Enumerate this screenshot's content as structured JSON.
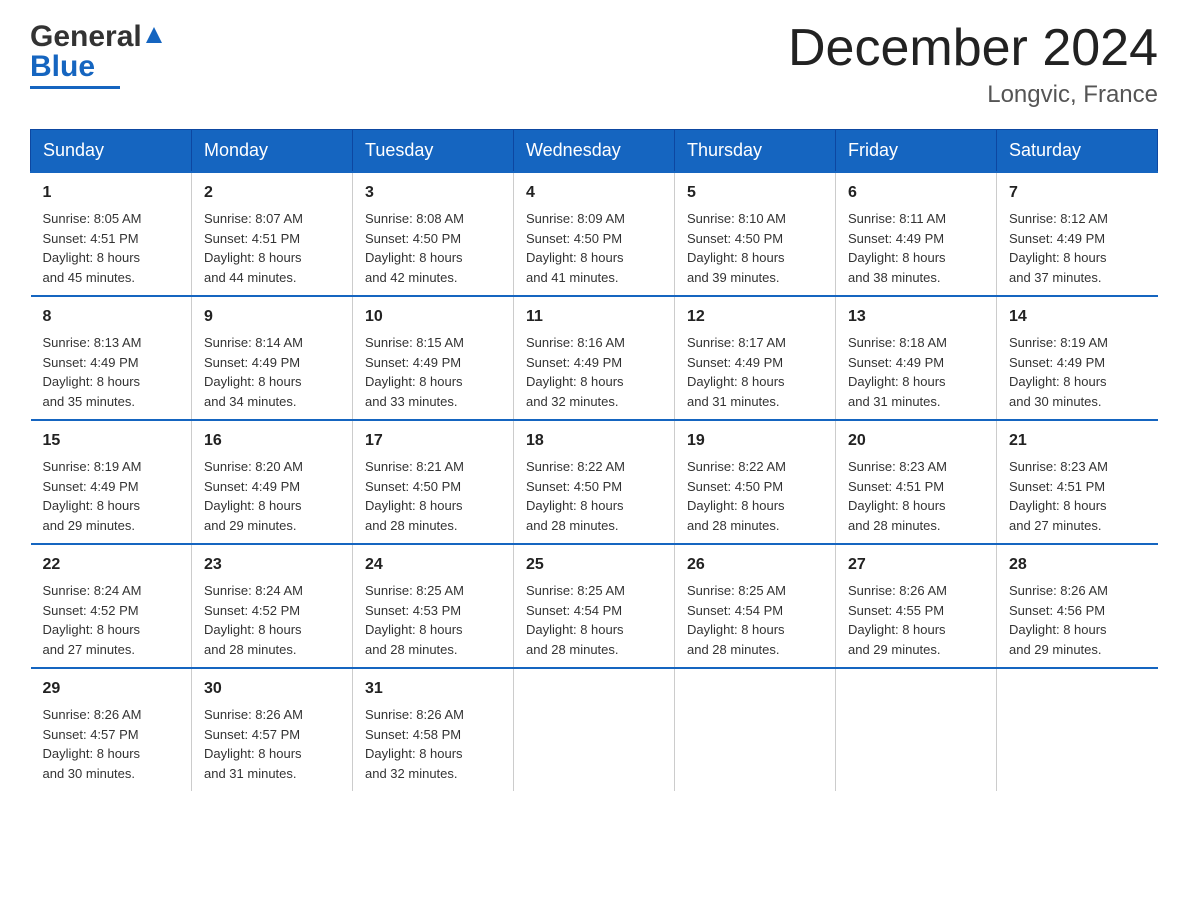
{
  "header": {
    "logo": {
      "line1": "General",
      "line2": "Blue"
    },
    "title": "December 2024",
    "subtitle": "Longvic, France"
  },
  "weekdays": [
    "Sunday",
    "Monday",
    "Tuesday",
    "Wednesday",
    "Thursday",
    "Friday",
    "Saturday"
  ],
  "weeks": [
    [
      {
        "day": "1",
        "sunrise": "8:05 AM",
        "sunset": "4:51 PM",
        "daylight": "8 hours and 45 minutes."
      },
      {
        "day": "2",
        "sunrise": "8:07 AM",
        "sunset": "4:51 PM",
        "daylight": "8 hours and 44 minutes."
      },
      {
        "day": "3",
        "sunrise": "8:08 AM",
        "sunset": "4:50 PM",
        "daylight": "8 hours and 42 minutes."
      },
      {
        "day": "4",
        "sunrise": "8:09 AM",
        "sunset": "4:50 PM",
        "daylight": "8 hours and 41 minutes."
      },
      {
        "day": "5",
        "sunrise": "8:10 AM",
        "sunset": "4:50 PM",
        "daylight": "8 hours and 39 minutes."
      },
      {
        "day": "6",
        "sunrise": "8:11 AM",
        "sunset": "4:49 PM",
        "daylight": "8 hours and 38 minutes."
      },
      {
        "day": "7",
        "sunrise": "8:12 AM",
        "sunset": "4:49 PM",
        "daylight": "8 hours and 37 minutes."
      }
    ],
    [
      {
        "day": "8",
        "sunrise": "8:13 AM",
        "sunset": "4:49 PM",
        "daylight": "8 hours and 35 minutes."
      },
      {
        "day": "9",
        "sunrise": "8:14 AM",
        "sunset": "4:49 PM",
        "daylight": "8 hours and 34 minutes."
      },
      {
        "day": "10",
        "sunrise": "8:15 AM",
        "sunset": "4:49 PM",
        "daylight": "8 hours and 33 minutes."
      },
      {
        "day": "11",
        "sunrise": "8:16 AM",
        "sunset": "4:49 PM",
        "daylight": "8 hours and 32 minutes."
      },
      {
        "day": "12",
        "sunrise": "8:17 AM",
        "sunset": "4:49 PM",
        "daylight": "8 hours and 31 minutes."
      },
      {
        "day": "13",
        "sunrise": "8:18 AM",
        "sunset": "4:49 PM",
        "daylight": "8 hours and 31 minutes."
      },
      {
        "day": "14",
        "sunrise": "8:19 AM",
        "sunset": "4:49 PM",
        "daylight": "8 hours and 30 minutes."
      }
    ],
    [
      {
        "day": "15",
        "sunrise": "8:19 AM",
        "sunset": "4:49 PM",
        "daylight": "8 hours and 29 minutes."
      },
      {
        "day": "16",
        "sunrise": "8:20 AM",
        "sunset": "4:49 PM",
        "daylight": "8 hours and 29 minutes."
      },
      {
        "day": "17",
        "sunrise": "8:21 AM",
        "sunset": "4:50 PM",
        "daylight": "8 hours and 28 minutes."
      },
      {
        "day": "18",
        "sunrise": "8:22 AM",
        "sunset": "4:50 PM",
        "daylight": "8 hours and 28 minutes."
      },
      {
        "day": "19",
        "sunrise": "8:22 AM",
        "sunset": "4:50 PM",
        "daylight": "8 hours and 28 minutes."
      },
      {
        "day": "20",
        "sunrise": "8:23 AM",
        "sunset": "4:51 PM",
        "daylight": "8 hours and 28 minutes."
      },
      {
        "day": "21",
        "sunrise": "8:23 AM",
        "sunset": "4:51 PM",
        "daylight": "8 hours and 27 minutes."
      }
    ],
    [
      {
        "day": "22",
        "sunrise": "8:24 AM",
        "sunset": "4:52 PM",
        "daylight": "8 hours and 27 minutes."
      },
      {
        "day": "23",
        "sunrise": "8:24 AM",
        "sunset": "4:52 PM",
        "daylight": "8 hours and 28 minutes."
      },
      {
        "day": "24",
        "sunrise": "8:25 AM",
        "sunset": "4:53 PM",
        "daylight": "8 hours and 28 minutes."
      },
      {
        "day": "25",
        "sunrise": "8:25 AM",
        "sunset": "4:54 PM",
        "daylight": "8 hours and 28 minutes."
      },
      {
        "day": "26",
        "sunrise": "8:25 AM",
        "sunset": "4:54 PM",
        "daylight": "8 hours and 28 minutes."
      },
      {
        "day": "27",
        "sunrise": "8:26 AM",
        "sunset": "4:55 PM",
        "daylight": "8 hours and 29 minutes."
      },
      {
        "day": "28",
        "sunrise": "8:26 AM",
        "sunset": "4:56 PM",
        "daylight": "8 hours and 29 minutes."
      }
    ],
    [
      {
        "day": "29",
        "sunrise": "8:26 AM",
        "sunset": "4:57 PM",
        "daylight": "8 hours and 30 minutes."
      },
      {
        "day": "30",
        "sunrise": "8:26 AM",
        "sunset": "4:57 PM",
        "daylight": "8 hours and 31 minutes."
      },
      {
        "day": "31",
        "sunrise": "8:26 AM",
        "sunset": "4:58 PM",
        "daylight": "8 hours and 32 minutes."
      },
      null,
      null,
      null,
      null
    ]
  ],
  "labels": {
    "sunrise": "Sunrise:",
    "sunset": "Sunset:",
    "daylight": "Daylight:"
  }
}
